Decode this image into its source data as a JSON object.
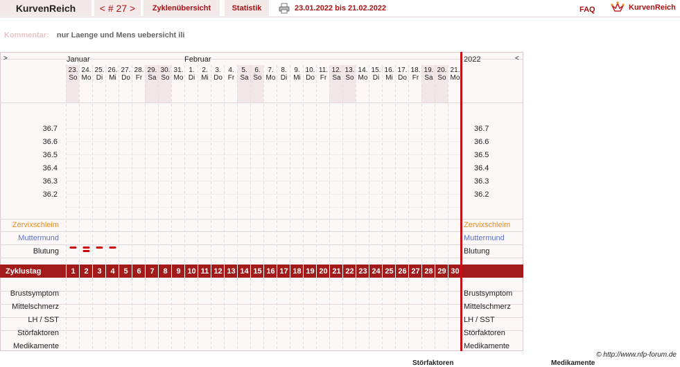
{
  "brand": "KurvenReich",
  "nav": {
    "cycle": "< # 27 >",
    "overview": "Zyklenübersicht",
    "stats": "Statistik",
    "date_range": "23.01.2022 bis 21.02.2022",
    "faq": "FAQ",
    "logo_text": "KurvenReich"
  },
  "comment": {
    "label": "Kommentar:",
    "text": "nur Laenge und Mens uebersicht ili"
  },
  "chart": {
    "left_arrow": ">",
    "right_arrow": "<",
    "year": "2022",
    "month_jan": "Januar",
    "month_feb": "Februar",
    "days": [
      {
        "n": "23.",
        "w": "So",
        "we": true
      },
      {
        "n": "24.",
        "w": "Mo",
        "we": false
      },
      {
        "n": "25.",
        "w": "Di",
        "we": false
      },
      {
        "n": "26.",
        "w": "Mi",
        "we": false
      },
      {
        "n": "27.",
        "w": "Do",
        "we": false
      },
      {
        "n": "28.",
        "w": "Fr",
        "we": false
      },
      {
        "n": "29.",
        "w": "Sa",
        "we": true
      },
      {
        "n": "30.",
        "w": "So",
        "we": true
      },
      {
        "n": "31.",
        "w": "Mo",
        "we": false
      },
      {
        "n": "1.",
        "w": "Di",
        "we": false
      },
      {
        "n": "2.",
        "w": "Mi",
        "we": false
      },
      {
        "n": "3.",
        "w": "Do",
        "we": false
      },
      {
        "n": "4.",
        "w": "Fr",
        "we": false
      },
      {
        "n": "5.",
        "w": "Sa",
        "we": true
      },
      {
        "n": "6.",
        "w": "So",
        "we": true
      },
      {
        "n": "7.",
        "w": "Mo",
        "we": false
      },
      {
        "n": "8.",
        "w": "Di",
        "we": false
      },
      {
        "n": "9.",
        "w": "Mi",
        "we": false
      },
      {
        "n": "10.",
        "w": "Do",
        "we": false
      },
      {
        "n": "11.",
        "w": "Fr",
        "we": false
      },
      {
        "n": "12.",
        "w": "Sa",
        "we": true
      },
      {
        "n": "13.",
        "w": "So",
        "we": true
      },
      {
        "n": "14.",
        "w": "Mo",
        "we": false
      },
      {
        "n": "15.",
        "w": "Di",
        "we": false
      },
      {
        "n": "16.",
        "w": "Mi",
        "we": false
      },
      {
        "n": "17.",
        "w": "Do",
        "we": false
      },
      {
        "n": "18.",
        "w": "Fr",
        "we": false
      },
      {
        "n": "19.",
        "w": "Sa",
        "we": true
      },
      {
        "n": "20.",
        "w": "So",
        "we": true
      },
      {
        "n": "21.",
        "w": "Mo",
        "we": false
      }
    ],
    "temps": [
      "36.7",
      "36.6",
      "36.5",
      "36.4",
      "36.3",
      "36.2"
    ],
    "rows": {
      "zervix": "Zervixschleim",
      "muttermund": "Muttermund",
      "blutung": "Blutung",
      "zyklustag": "Zyklustag",
      "brust": "Brustsymptom",
      "mittel": "Mittelschmerz",
      "lh": "LH / SST",
      "stoer": "Störfaktoren",
      "medi": "Medikamente"
    },
    "bleeding": [
      {
        "day": 1,
        "marks": 1
      },
      {
        "day": 2,
        "marks": 2
      },
      {
        "day": 3,
        "marks": 1
      },
      {
        "day": 4,
        "marks": 1
      }
    ],
    "cycle_days": [
      "1",
      "2",
      "3",
      "4",
      "5",
      "6",
      "7",
      "8",
      "9",
      "10",
      "11",
      "12",
      "13",
      "14",
      "15",
      "16",
      "17",
      "18",
      "19",
      "20",
      "21",
      "22",
      "23",
      "24",
      "25",
      "26",
      "27",
      "28",
      "29",
      "30"
    ]
  },
  "footer": {
    "copyright": "© http://www.nfp-forum.de",
    "cut1": "Störfaktoren",
    "cut2": "Medikamente"
  },
  "colors": {
    "accent": "#a31a1a",
    "weekend": "#f3e6e6",
    "zervix": "#e8891a",
    "muttermund": "#5a6fc8"
  }
}
